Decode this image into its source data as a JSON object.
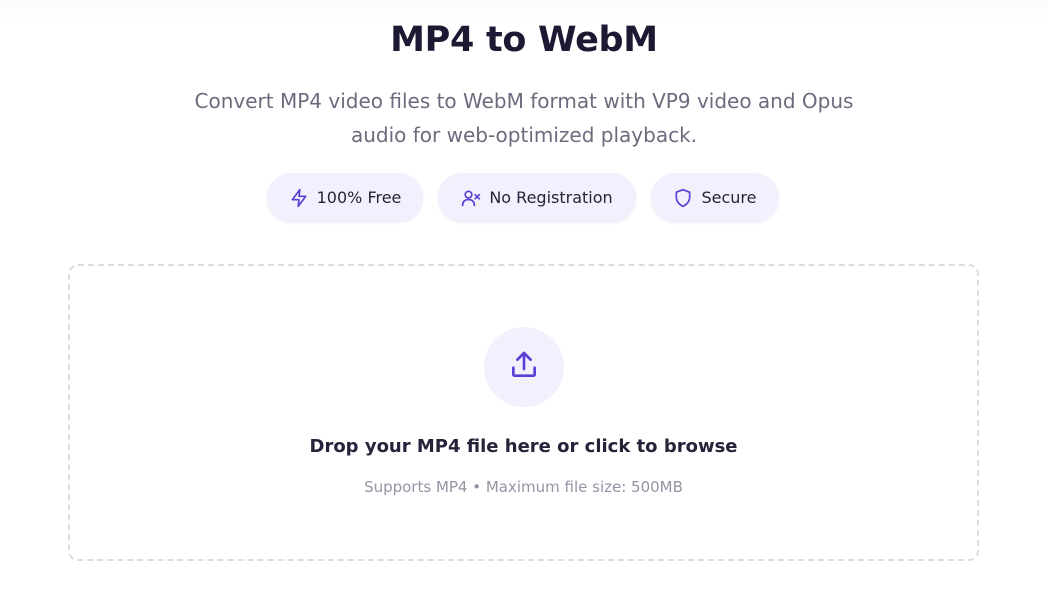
{
  "page": {
    "title": "MP4 to WebM",
    "description": "Convert MP4 video files to WebM format with VP9 video and Opus audio for web-optimized playback."
  },
  "badges": [
    {
      "label": "100% Free",
      "icon": "lightning-icon"
    },
    {
      "label": "No Registration",
      "icon": "user-x-icon"
    },
    {
      "label": "Secure",
      "icon": "shield-icon"
    }
  ],
  "upload": {
    "icon": "upload-icon",
    "prompt": "Drop your MP4 file here or click to browse",
    "hint": "Supports MP4 • Maximum file size: 500MB"
  },
  "colors": {
    "accent": "#5b3fd6",
    "badge_bg": "#f2f0fc",
    "title": "#1c1a33",
    "muted": "#6e6a7e"
  }
}
